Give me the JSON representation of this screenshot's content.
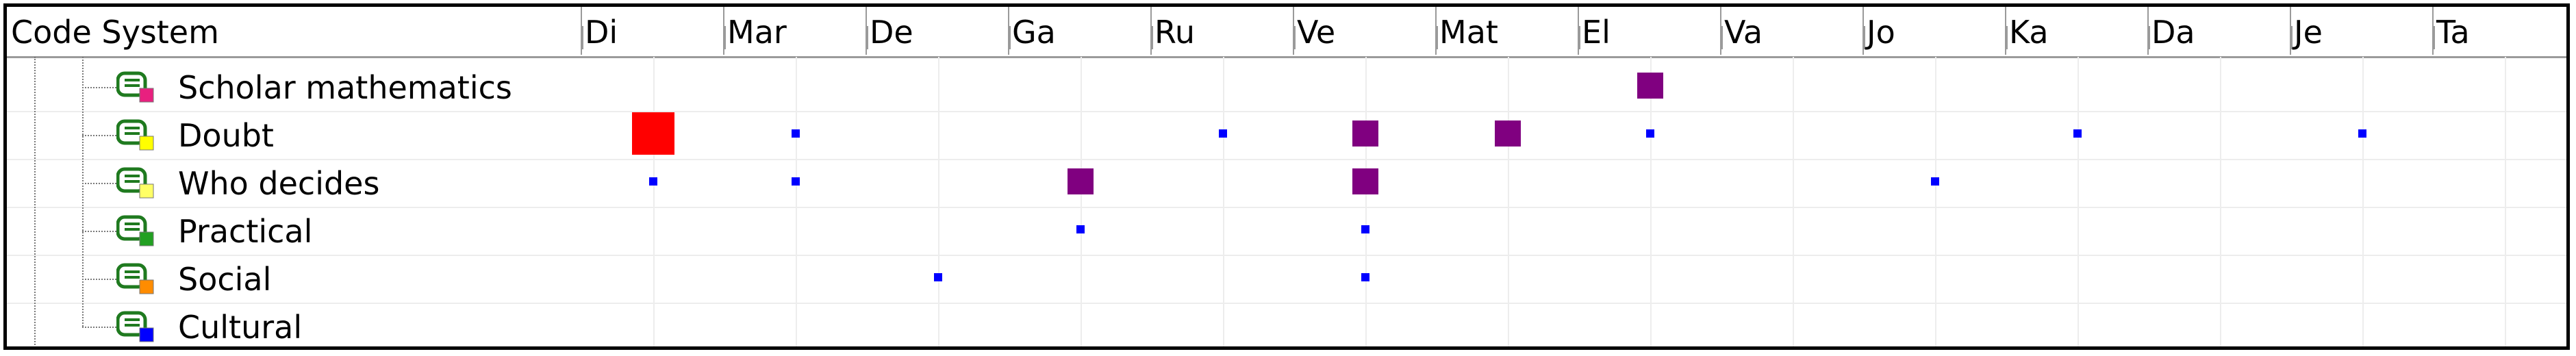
{
  "header": {
    "code_system_label": "Code System",
    "documents": [
      "Di",
      "Mar",
      "De",
      "Ga",
      "Ru",
      "Ve",
      "Mat",
      "El",
      "Va",
      "Jo",
      "Ka",
      "Da",
      "Je",
      "Ta"
    ]
  },
  "codes": [
    {
      "label": "Scholar mathematics",
      "color": "#e8207f",
      "icon": "code-icon"
    },
    {
      "label": "Doubt",
      "color": "#ffff00",
      "icon": "code-icon"
    },
    {
      "label": "Who decides",
      "color": "#ffff66",
      "icon": "code-icon"
    },
    {
      "label": "Practical",
      "color": "#22a022",
      "icon": "code-icon"
    },
    {
      "label": "Social",
      "color": "#ff8c00",
      "icon": "code-icon"
    },
    {
      "label": "Cultural",
      "color": "#0000ff",
      "icon": "code-icon"
    }
  ],
  "colors": {
    "small": "#0000ff",
    "medium": "#800080",
    "large": "#ff0000"
  },
  "matrix": [
    {
      "code": "Scholar mathematics",
      "cells": [
        {
          "doc": "El",
          "level": "medium"
        }
      ]
    },
    {
      "code": "Doubt",
      "cells": [
        {
          "doc": "Di",
          "level": "large"
        },
        {
          "doc": "Mar",
          "level": "small"
        },
        {
          "doc": "Ru",
          "level": "small"
        },
        {
          "doc": "Ve",
          "level": "medium"
        },
        {
          "doc": "Mat",
          "level": "medium"
        },
        {
          "doc": "El",
          "level": "small"
        },
        {
          "doc": "Ka",
          "level": "small"
        },
        {
          "doc": "Je",
          "level": "small"
        }
      ]
    },
    {
      "code": "Who decides",
      "cells": [
        {
          "doc": "Di",
          "level": "small"
        },
        {
          "doc": "Mar",
          "level": "small"
        },
        {
          "doc": "Ga",
          "level": "medium"
        },
        {
          "doc": "Ve",
          "level": "medium"
        },
        {
          "doc": "Jo",
          "level": "small"
        }
      ]
    },
    {
      "code": "Practical",
      "cells": [
        {
          "doc": "Ga",
          "level": "small"
        },
        {
          "doc": "Ve",
          "level": "small"
        }
      ]
    },
    {
      "code": "Social",
      "cells": [
        {
          "doc": "De",
          "level": "small"
        },
        {
          "doc": "Ve",
          "level": "small"
        }
      ]
    },
    {
      "code": "Cultural",
      "cells": []
    }
  ]
}
